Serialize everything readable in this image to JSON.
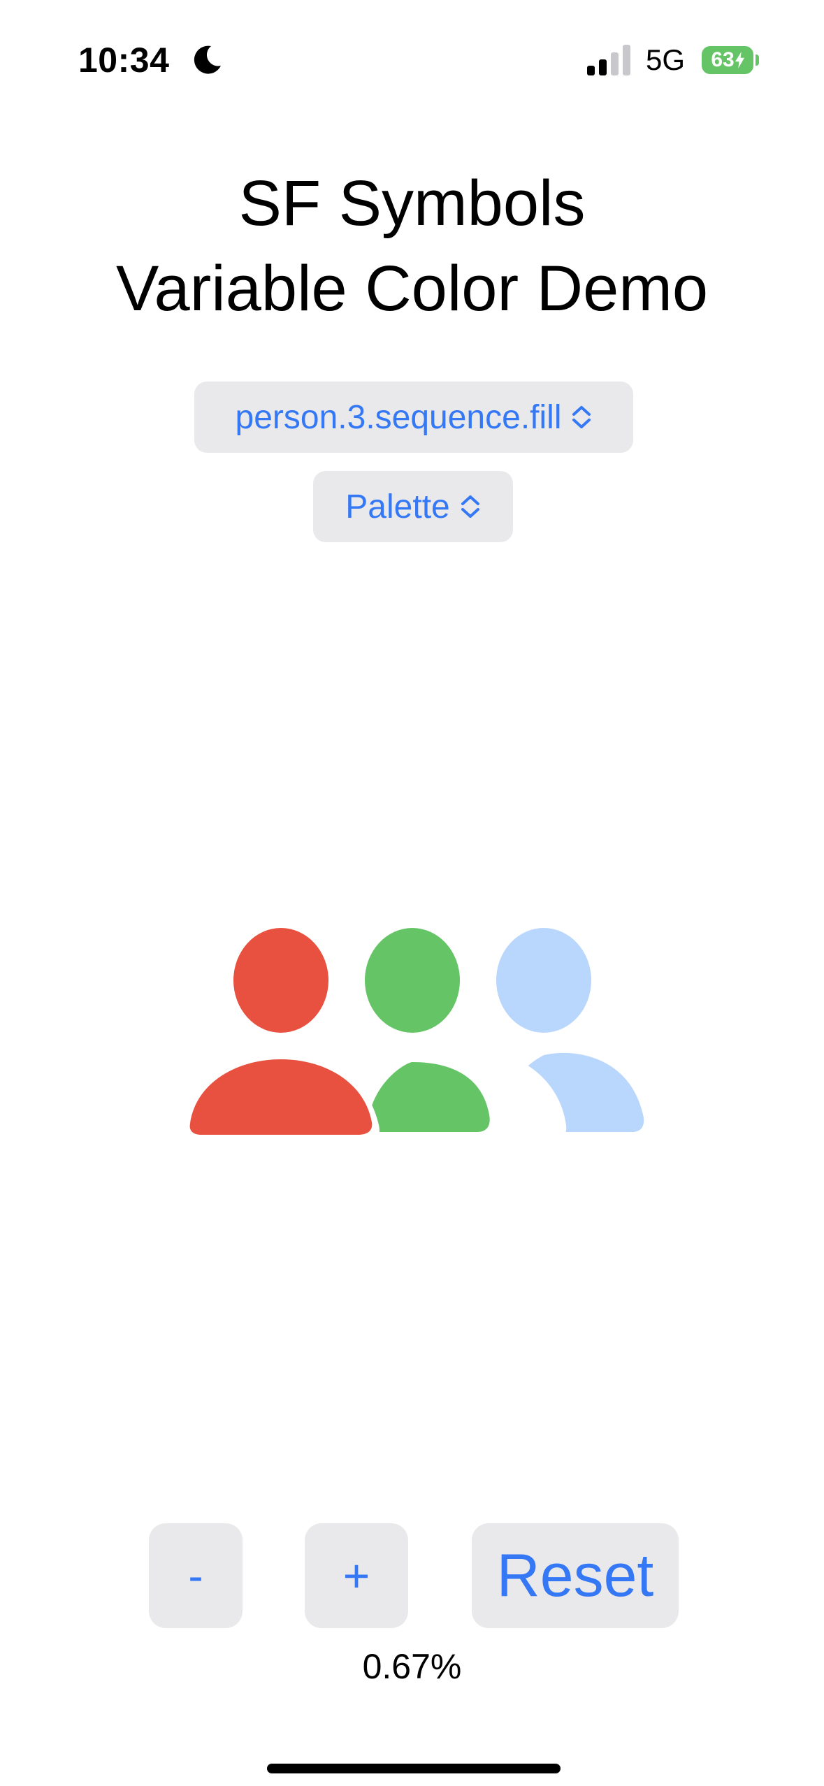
{
  "status_bar": {
    "time": "10:34",
    "focus_icon": "moon-icon",
    "signal_icon": "cellular-signal-icon",
    "signal_bars_filled": 2,
    "signal_bars_total": 4,
    "network": "5G",
    "battery_percent": "63",
    "battery_charging": true,
    "battery_color": "#65c466"
  },
  "title": {
    "line1": "SF Symbols",
    "line2": "Variable Color Demo"
  },
  "symbol_picker": {
    "value": "person.3.sequence.fill",
    "icon": "chevron-up-down-icon"
  },
  "rendering_mode_picker": {
    "value": "Palette",
    "icon": "chevron-up-down-icon"
  },
  "symbol_preview": {
    "symbol_name": "person.3.sequence.fill",
    "colors": [
      "#e85140",
      "#65c466",
      "#b9d6fc"
    ]
  },
  "controls": {
    "decrease_label": "-",
    "increase_label": "+",
    "reset_label": "Reset"
  },
  "variable_value_label": "0.67%",
  "accent_color": "#3478f6"
}
